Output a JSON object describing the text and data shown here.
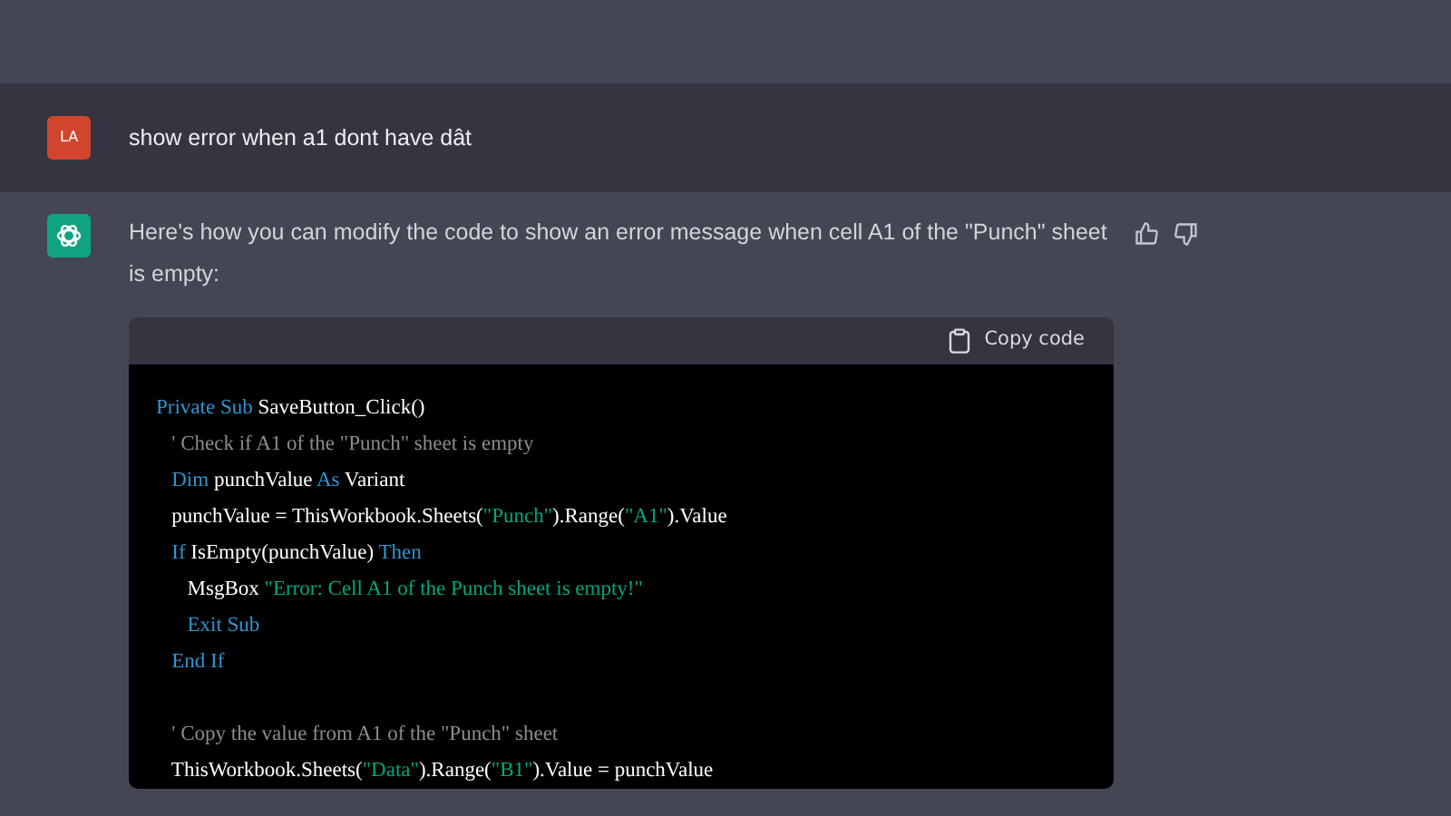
{
  "messages": [
    {
      "kind": "user",
      "avatar": "LA",
      "text": "show error when a1 dont have dât"
    },
    {
      "kind": "assistant",
      "text": "Here's how you can modify the code to show an error message when cell A1 of the \"Punch\" sheet is empty:",
      "code": {
        "copy_label": "Copy code",
        "blocks": [
          [
            [
              {
                "kind": "kw",
                "text": "Private Sub"
              },
              {
                "kind": "plain",
                "text": " SaveButton_Click()"
              }
            ],
            [
              {
                "kind": "comment",
                "text": "   ' Check if A1 of the \"Punch\" sheet is empty"
              }
            ],
            [
              {
                "kind": "kw",
                "text": "   Dim"
              },
              {
                "kind": "plain",
                "text": " punchValue "
              },
              {
                "kind": "kw",
                "text": "As"
              },
              {
                "kind": "plain",
                "text": " Variant"
              }
            ],
            [
              {
                "kind": "plain",
                "text": "   punchValue = ThisWorkbook.Sheets("
              },
              {
                "kind": "str",
                "text": "\"Punch\""
              },
              {
                "kind": "plain",
                "text": ").Range("
              },
              {
                "kind": "str",
                "text": "\"A1\""
              },
              {
                "kind": "plain",
                "text": ").Value"
              }
            ],
            [
              {
                "kind": "kw",
                "text": "   If"
              },
              {
                "kind": "plain",
                "text": " IsEmpty(punchValue) "
              },
              {
                "kind": "kw",
                "text": "Then"
              }
            ],
            [
              {
                "kind": "plain",
                "text": "      MsgBox "
              },
              {
                "kind": "str",
                "text": "\"Error: Cell A1 of the Punch sheet is empty!\""
              }
            ],
            [
              {
                "kind": "kw",
                "text": "      Exit Sub"
              }
            ],
            [
              {
                "kind": "kw",
                "text": "   End If"
              }
            ]
          ],
          [
            [
              {
                "kind": "comment",
                "text": "   ' Copy the value from A1 of the \"Punch\" sheet"
              }
            ],
            [
              {
                "kind": "plain",
                "text": "   ThisWorkbook.Sheets("
              },
              {
                "kind": "str",
                "text": "\"Data\""
              },
              {
                "kind": "plain",
                "text": ").Range("
              },
              {
                "kind": "str",
                "text": "\"B1\""
              },
              {
                "kind": "plain",
                "text": ").Value = punchValue"
              }
            ]
          ]
        ]
      }
    }
  ]
}
